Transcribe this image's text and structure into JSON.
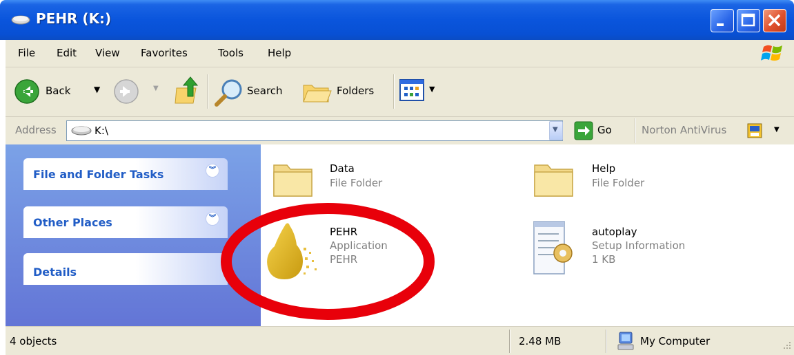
{
  "window": {
    "title": "PEHR (K:)"
  },
  "menu": [
    "File",
    "Edit",
    "View",
    "Favorites",
    "Tools",
    "Help"
  ],
  "toolbar": {
    "back_label": "Back",
    "search_label": "Search",
    "folders_label": "Folders"
  },
  "address": {
    "label": "Address",
    "value": "K:\\",
    "go_label": "Go",
    "norton_label": "Norton AntiVirus"
  },
  "tasks": [
    {
      "title": "File and Folder Tasks"
    },
    {
      "title": "Other Places"
    },
    {
      "title": "Details"
    }
  ],
  "items": [
    {
      "name": "Data",
      "lines": [
        "File Folder"
      ],
      "icon": "folder-icon"
    },
    {
      "name": "Help",
      "lines": [
        "File Folder"
      ],
      "icon": "folder-icon"
    },
    {
      "name": "PEHR",
      "lines": [
        "Application",
        "PEHR"
      ],
      "icon": "pear-app-icon"
    },
    {
      "name": "autoplay",
      "lines": [
        "Setup Information",
        "1 KB"
      ],
      "icon": "setup-info-icon"
    }
  ],
  "status": {
    "objects": "4 objects",
    "size": "2.48 MB",
    "location": "My Computer"
  },
  "colors": {
    "titlebar": "#0a55dc",
    "annotation": "#e8000a",
    "task_title": "#215dc6"
  }
}
